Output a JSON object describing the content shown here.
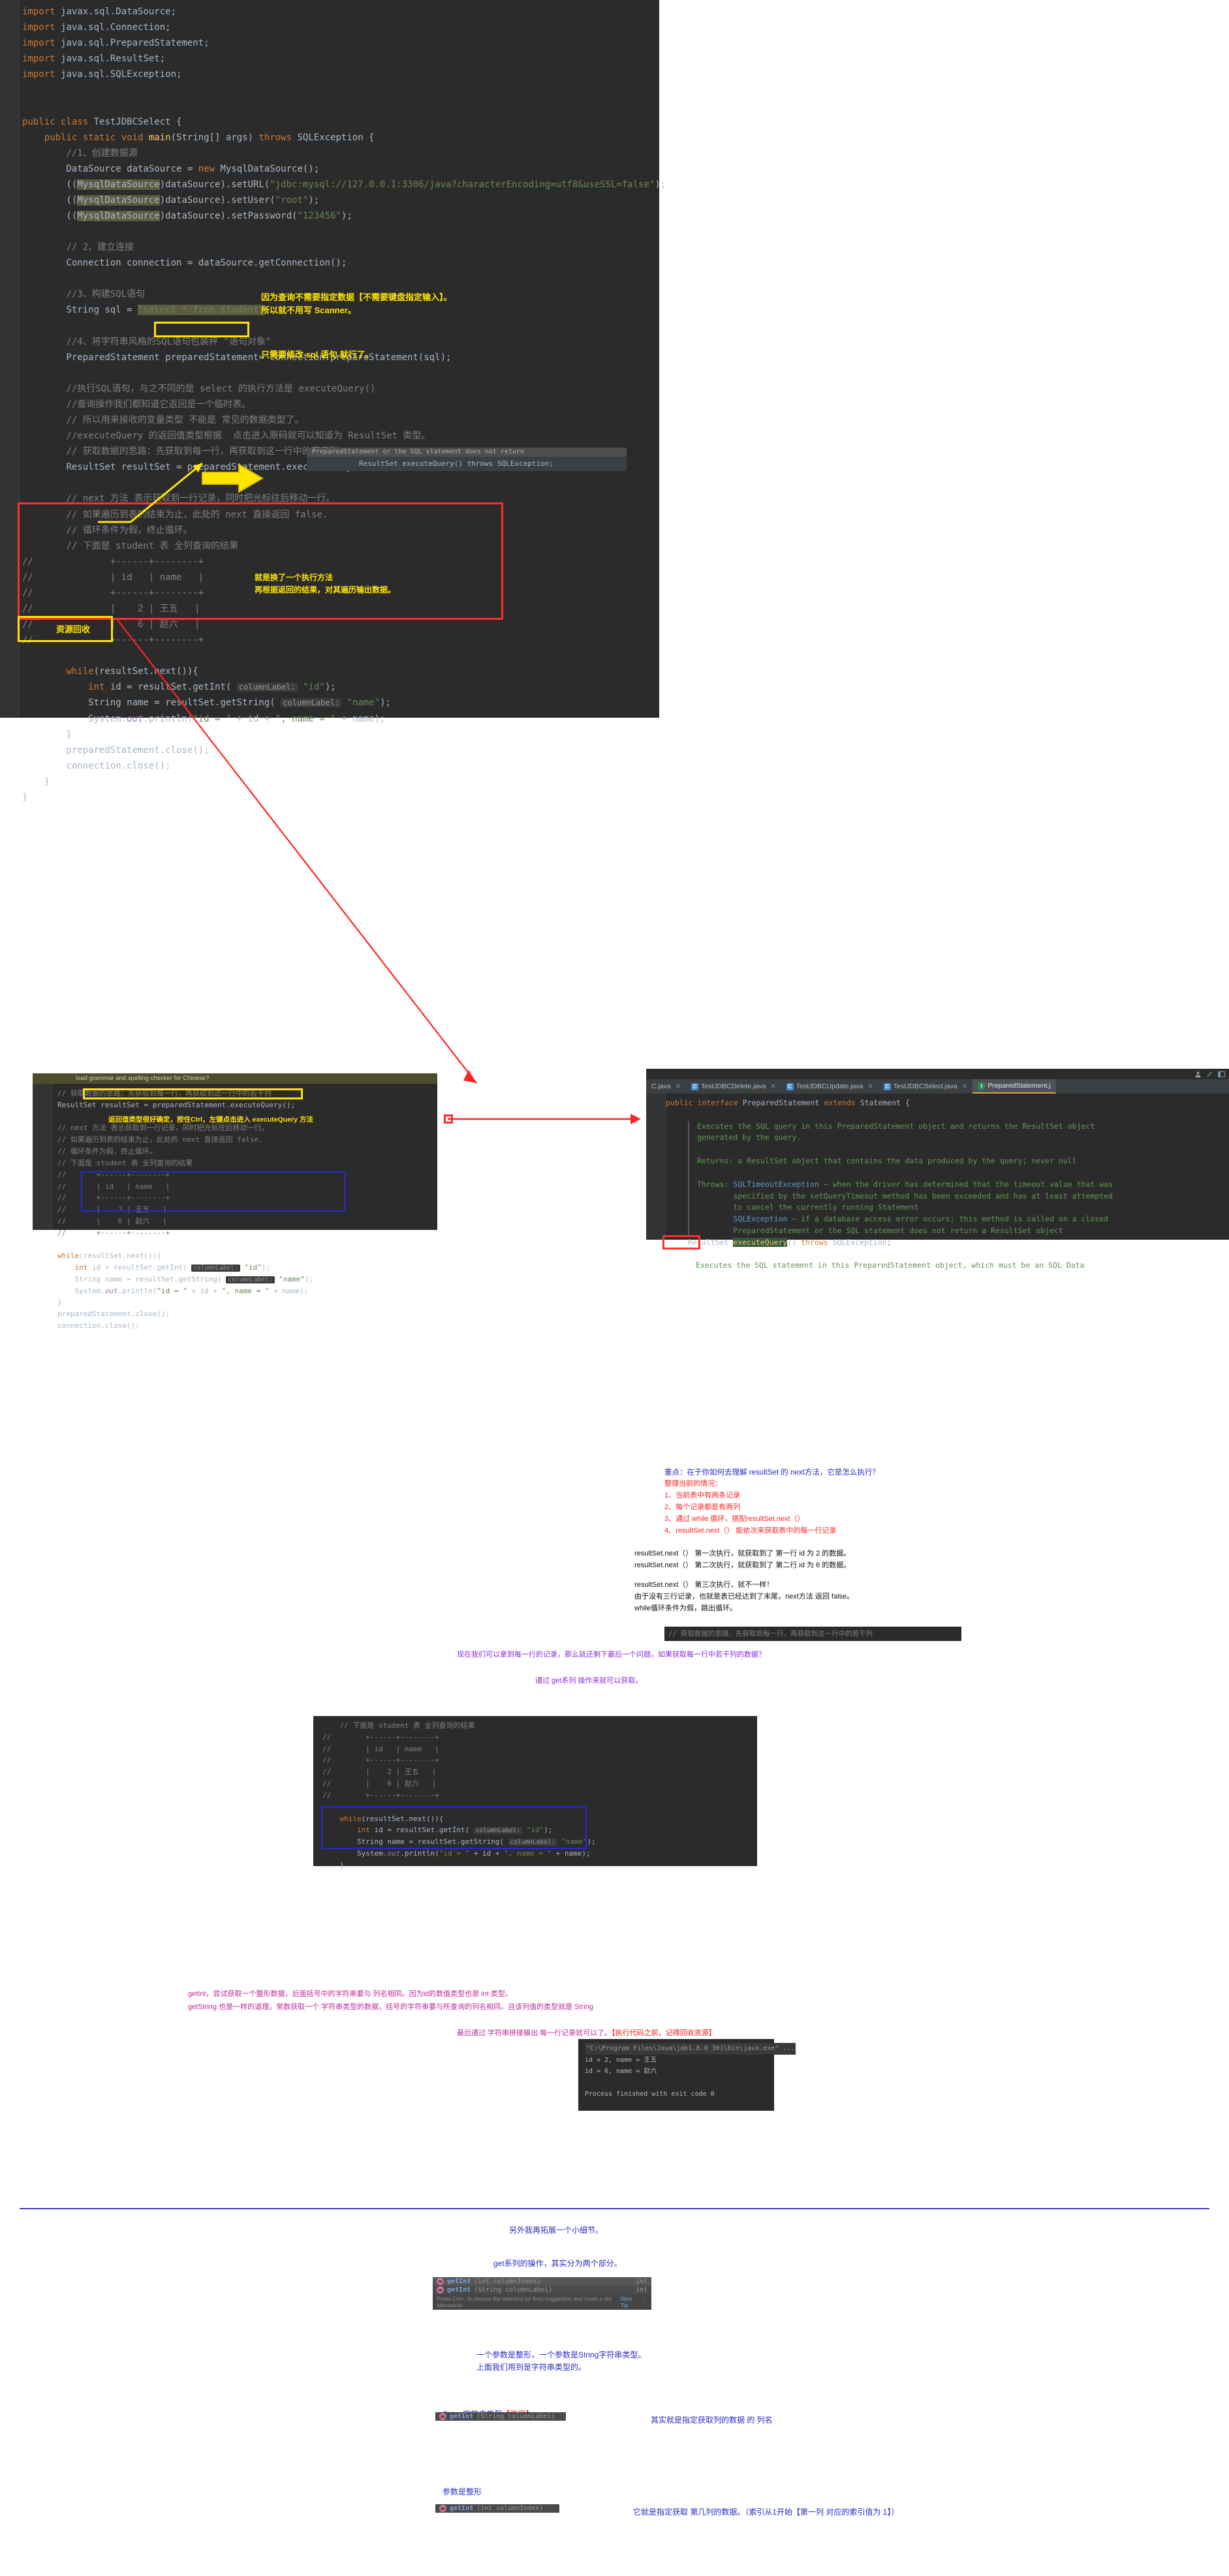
{
  "panel_main": {
    "name": "TestJDBCSelect.java editor",
    "lines": [
      "import javax.sql.DataSource;",
      "import java.sql.Connection;",
      "import java.sql.PreparedStatement;",
      "import java.sql.ResultSet;",
      "import java.sql.SQLException;",
      "",
      "public class TestJDBCSelect {",
      "    public static void main(String[] args) throws SQLException {",
      "        //1、创建数据源",
      "        DataSource dataSource = new MysqlDataSource();",
      "        ((MysqlDataSource)dataSource).setURL(\"jdbc:mysql://127.0.0.1:3306/java?characterEncoding=utf8&useSSL=false\");",
      "        ((MysqlDataSource)dataSource).setUser(\"root\");",
      "        ((MysqlDataSource)dataSource).setPassword(\"123456\");",
      "",
      "        // 2、建立连接",
      "        Connection connection = dataSource.getConnection();",
      "",
      "        //3、构建SQL语句",
      "        String sql = \"select * from student\";",
      "",
      "        //4、将字符串风格的SQL语句包装秤 \"语句对象\"",
      "        PreparedStatement preparedStatement= connection.prepareStatement(sql);",
      "",
      "        //执行SQL语句，与之不同的是 select 的执行方法是 executeQuery()",
      "        //查询操作我们都知道它返回是一个临时表。",
      "        // 所以用来接收的变量类型 不能是 常见的数据类型了。",
      "        //executeQuery 的返回值类型根据  点击进入原码就可以知道为 ResultSet 类型。",
      "        // 获取数据的思路：先获取到每一行，再获取到这一行中的若干列",
      "        ResultSet resultSet = preparedStatement.executeQuery();",
      "",
      "        // next 方法 表示获取到一行记录，同时把光标往后移动一行。",
      "        // 如果遍历到表的结束为止，此处的 next 直接返回 false.",
      "        // 循环条件为假，终止循环。",
      "        // 下面是 student 表 全列查询的结果",
      "        //        +------+--------+",
      "        //        | id   | name   |",
      "        //        +------+--------+",
      "        //        |    2 | 王五   |",
      "        //        |    6 | 赵六   |",
      "        //        +------+--------+",
      "",
      "        while(resultSet.next()){",
      "            int id = resultSet.getInt( columnLabel: \"id\");",
      "            String name = resultSet.getString( columnLabel: \"name\");",
      "            System.out.println(\"id = \" + id + \", name = \" + name);",
      "        }",
      "        preparedStatement.close();",
      "        connection.close();",
      "    }",
      "}"
    ],
    "sql_value": "select * from student",
    "hint_label": "columnLabel:"
  },
  "annotations": {
    "note_scanner": "因为查询不需要指定数据【不需要键盘指定输入】。\n所以就不用写 Scanner。",
    "note_onlysql": "只需要修改 sql 语句 就行了。",
    "note_method": "就是换了一个执行方法\n再根据返回的结果，对其遍历输出数据。",
    "note_resource": "资源回收",
    "note_ctrl": "返回值类型很好确定，按住Ctrl，左键点击进入 executeQuery 方法",
    "signature_popup": "ResultSet executeQuery() throws SQLException;",
    "signature_tooltip": "PreparedStatement or the SQL statement does not return"
  },
  "panel2": {
    "banner": "load grammar and spelling checker for Chinese?",
    "lines": [
      "// 获取数据的思路：先获取到每一行，再获取到这一行中的若干列",
      "ResultSet resultSet = preparedStatement.executeQuery();",
      "",
      "// next 方法 表示获取到一行记录，同时把光标往后移动一行。",
      "// 如果遍历到表的结束为止，此处的 next 直接返回 false.",
      "// 循环条件为假，终止循环。",
      "// 下面是 student 表 全列查询的结果",
      "//        +------+--------+",
      "//        | id   | name   |",
      "//        +------+--------+",
      "//        |    2 | 王五   |",
      "//        |    6 | 赵六   |",
      "//        +------+--------+",
      "",
      "while(resultSet.next()){",
      "    int id = resultSet.getInt( columnLabel: \"id\");",
      "    String name = resultSet.getString( columnLabel: \"name\");",
      "    System.out.println(\"id = \" + id + \", name = \" + name);",
      "}",
      "preparedStatement.close();",
      "connection.close();"
    ]
  },
  "panel3": {
    "tabs": [
      {
        "label": "C.java",
        "icon": "class-icon",
        "active": false
      },
      {
        "label": "TestJDBCDelete.java",
        "icon": "class-icon",
        "active": false
      },
      {
        "label": "TestJDBCUpdate.java",
        "icon": "class-icon",
        "active": false
      },
      {
        "label": "TestJDBCSelect.java",
        "icon": "class-icon",
        "active": false
      },
      {
        "label": "PreparedStatement.j",
        "icon": "interface-icon",
        "active": true
      }
    ],
    "declaration": "public interface PreparedStatement extends Statement {",
    "doc": [
      "Executes the SQL query in this PreparedStatement object and returns the ResultSet object",
      "generated by the query.",
      "Returns: a ResultSet object that contains the data produced by the query; never null",
      "Throws: SQLTimeoutException – when the driver has determined that the timeout value that was",
      "        specified by the setQueryTimeout method has been exceeded and has at least attempted",
      "        to cancel the currently running Statement",
      "        SQLException – if a database access error occurs; this method is called on a closed",
      "        PreparedStatement or the SQL statement does not return a ResultSet object"
    ],
    "method_signature": "ResultSet executeQuery() throws SQLException;",
    "doc_after": "Executes the SQL statement in this PreparedStatement object, which must be an SQL Data"
  },
  "explain_block": {
    "title": "重点：在于你如何去理解 resultSet 的 next方法，它是怎么执行？",
    "subtitle": "整理当前的情况：",
    "points": [
      "1、当前表中有两条记录",
      "2、每个记录都是有两列",
      "3、通过 while 循环，搭配resultSet.next（）",
      "4、resultSet.next（） 能依次来获取表中的每一行记录"
    ],
    "detail": [
      "resultSet.next（）   第一次执行，就获取到了 第一行 id 为 2 的数据。",
      "resultSet.next（）   第二次执行，就获取到了 第二行 id 为 6 的数据。"
    ],
    "detail2": [
      "resultSet.next（）   第三次执行，就不一样！",
      "由于没有三行记录，也就是表已经达到了末尾，next方法 返回 false。",
      "while循环条件为假，跳出循环。"
    ],
    "question": "现在我们可以拿到每一行的记录，那么就还剩下最后一个问题，如果获取每一行中若干列的数据？",
    "answer": "通过 get系列 操作来就可以获取。"
  },
  "panel4": {
    "lines": [
      "// 下面是 student 表 全列查询的结果",
      "//        +------+--------+",
      "//        | id   | name   |",
      "//        +------+--------+",
      "//        |    2 | 王五   |",
      "//        |    6 | 赵六   |",
      "//        +------+--------+",
      "",
      "while(resultSet.next()){",
      "    int id = resultSet.getInt( columnLabel: \"id\");",
      "    String name = resultSet.getString( columnLabel: \"name\");",
      "    System.out.println(\"id = \" + id + \", name = \" + name);",
      "}"
    ]
  },
  "get_explain": {
    "line1": "getInt，尝试获取一个整形数据，后面括号中的字符串要与 列名相同。因为id的数值类型也是 int 类型。",
    "line2": "getString 也是一样的道理。常数获取一个 字符串类型的数据，括号的字符串要与所查询的列名相同。且该列值的类型就是 String",
    "line3": "最后通过 字符串拼接输出 每一行记录就可以了。",
    "line3_red": "【执行代码之前，记得回收资源】"
  },
  "console": {
    "cmdline": "\"C:\\Program Files\\Java\\jdk1.8.0_301\\bin\\java.exe\" ...",
    "lines": [
      "id = 2, name = 王五",
      "id = 6, name = 赵六",
      "",
      "Process finished with exit code 0"
    ]
  },
  "bottom": {
    "heading1": "另外我再拓展一个小细节。",
    "heading2": "get系列的操作，其实分为两个部分。",
    "popup1": {
      "rows": [
        {
          "name": "getInt",
          "args": "(int columnIndex)",
          "ret": "int",
          "icon": "method-icon"
        },
        {
          "name": "getInt",
          "args": "(String columnLabel)",
          "ret": "int",
          "icon": "method-icon"
        }
      ],
      "footer": "Press Ctrl+. to choose the selected (or first) suggestion and insert a dot afterwards",
      "footer_link": "Next Tip"
    },
    "caption1": "一个参数是整形，一个参数是String字符串类型。\n上面我们用到是字符串类型的。",
    "label_string": "String字符串类型",
    "label_string_red": "【常用】",
    "popup2": {
      "name": "getInt",
      "args": "(String columnLabel)",
      "icon": "method-icon"
    },
    "caption2": "其实就是指定获取列的数据 的 列名",
    "label_int": "参数是整形",
    "popup3": {
      "name": "getInt",
      "args": "(int columnIndex)",
      "icon": "method-icon"
    },
    "caption3": "它就是指定获取 第几列的数据。（索引从1开始【第一列 对应的索引值为 1】）"
  },
  "colors": {
    "editor_bg": "#2b2b2b",
    "yellow": "#ffe500",
    "red": "#ff2424",
    "blue": "#2b2bc8",
    "purple": "#8a2be2",
    "magenta": "#c02898"
  }
}
